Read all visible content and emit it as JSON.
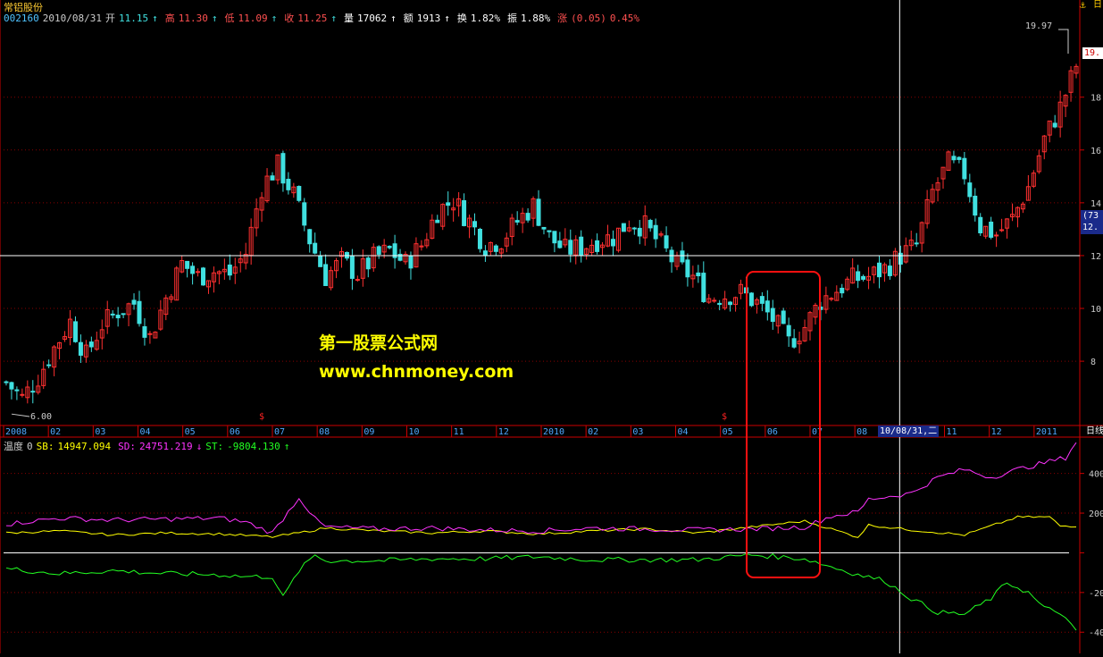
{
  "stock": {
    "name": "常铝股份",
    "code": "002160",
    "date": "2010/08/31",
    "open_label": "开",
    "open": "11.15",
    "high_label": "高",
    "high": "11.30",
    "low_label": "低",
    "low": "11.09",
    "close_label": "收",
    "close": "11.25",
    "vol_label": "量",
    "vol": "17062",
    "amt_label": "额",
    "amt": "1913",
    "turn_label": "换",
    "turn": "1.82%",
    "amp_label": "振",
    "amp": "1.88%",
    "chg_label": "涨",
    "chg": "(0.05)",
    "chg_pct": "0.45%"
  },
  "price_markers": {
    "max": "19.97",
    "min": "6.00",
    "right_tag": "19.",
    "cursor_tag1": "(73",
    "cursor_tag2": "12."
  },
  "watermark": {
    "line1": "第一股票公式网",
    "line2": "www.chnmoney.com"
  },
  "period_button": "日线",
  "cursor_date": "10/08/31,二",
  "signal_marker": "$",
  "indicator": {
    "name": "温度",
    "param": "0",
    "sb_label": "SB:",
    "sb_value": "14947.094",
    "sd_label": "SD:",
    "sd_value": "24751.219",
    "st_label": "ST:",
    "st_value": "-9804.130"
  },
  "colors": {
    "up": "#ff3030",
    "down": "#40e0e0",
    "sb": "#ffff00",
    "sd": "#ff33ff",
    "st": "#22ff22",
    "grid": "#880000",
    "axis": "#cc0000",
    "box": "#ff1010"
  },
  "chart_data": [
    {
      "type": "candlestick",
      "title": "",
      "x_tick_labels": [
        "2008",
        "02",
        "03",
        "04",
        "05",
        "06",
        "07",
        "08",
        "09",
        "10",
        "11",
        "12",
        "2010",
        "02",
        "03",
        "04",
        "05",
        "06",
        "07",
        "08",
        "10/08/31,二",
        "11",
        "12",
        "2011"
      ],
      "y_ticks": [
        8,
        10,
        12,
        14,
        16,
        18
      ],
      "ylim": [
        5.6,
        20.8
      ],
      "y_max_marked": 19.97,
      "y_min_marked": 6.0,
      "crosshair_y": 12.0,
      "close_path": [
        [
          0,
          7.2
        ],
        [
          3,
          6.6
        ],
        [
          6,
          7.4
        ],
        [
          9,
          8.5
        ],
        [
          12,
          9.5
        ],
        [
          15,
          8.2
        ],
        [
          18,
          9.4
        ],
        [
          21,
          9.9
        ],
        [
          24,
          10.2
        ],
        [
          27,
          8.9
        ],
        [
          30,
          10.4
        ],
        [
          33,
          11.7
        ],
        [
          36,
          11.2
        ],
        [
          39,
          11.4
        ],
        [
          42,
          11.3
        ],
        [
          45,
          12.1
        ],
        [
          48,
          14.6
        ],
        [
          51,
          15.4
        ],
        [
          54,
          14.3
        ],
        [
          57,
          12.6
        ],
        [
          60,
          11.2
        ],
        [
          63,
          11.8
        ],
        [
          66,
          11.3
        ],
        [
          69,
          11.9
        ],
        [
          72,
          12.2
        ],
        [
          75,
          11.7
        ],
        [
          78,
          12.4
        ],
        [
          81,
          13.7
        ],
        [
          84,
          14.1
        ],
        [
          87,
          13.3
        ],
        [
          90,
          12.4
        ],
        [
          93,
          12.6
        ],
        [
          96,
          13.3
        ],
        [
          99,
          13.9
        ],
        [
          102,
          12.7
        ],
        [
          105,
          12.2
        ],
        [
          108,
          12.3
        ],
        [
          111,
          12.6
        ],
        [
          114,
          12.7
        ],
        [
          117,
          13.3
        ],
        [
          120,
          13.1
        ],
        [
          123,
          12.4
        ],
        [
          126,
          11.6
        ],
        [
          129,
          11.2
        ],
        [
          132,
          10.4
        ],
        [
          135,
          10.5
        ],
        [
          138,
          10.6
        ],
        [
          141,
          10.2
        ],
        [
          144,
          9.6
        ],
        [
          147,
          8.7
        ],
        [
          150,
          9.3
        ],
        [
          153,
          10.3
        ],
        [
          156,
          10.7
        ],
        [
          159,
          11.1
        ],
        [
          162,
          11.2
        ],
        [
          165,
          11.5
        ],
        [
          168,
          12.0
        ],
        [
          171,
          12.4
        ],
        [
          174,
          14.4
        ],
        [
          177,
          15.5
        ],
        [
          180,
          15.1
        ],
        [
          183,
          13.1
        ],
        [
          186,
          12.8
        ],
        [
          189,
          13.4
        ],
        [
          192,
          14.6
        ],
        [
          195,
          16.4
        ],
        [
          198,
          17.6
        ],
        [
          201,
          19.2
        ]
      ],
      "n_candles": 202
    },
    {
      "type": "line",
      "title": "",
      "y_ticks": [
        400,
        200,
        0,
        -200,
        -400
      ],
      "ylim": [
        -480,
        520
      ],
      "series": [
        {
          "name": "SB",
          "points": [
            [
              0,
              100
            ],
            [
              10,
              110
            ],
            [
              20,
              90
            ],
            [
              30,
              100
            ],
            [
              40,
              95
            ],
            [
              50,
              80
            ],
            [
              55,
              100
            ],
            [
              60,
              125
            ],
            [
              70,
              110
            ],
            [
              80,
              100
            ],
            [
              90,
              110
            ],
            [
              100,
              95
            ],
            [
              110,
              110
            ],
            [
              120,
              120
            ],
            [
              130,
              100
            ],
            [
              140,
              130
            ],
            [
              150,
              160
            ],
            [
              160,
              80
            ],
            [
              162,
              140
            ],
            [
              170,
              115
            ],
            [
              180,
              90
            ],
            [
              190,
              180
            ],
            [
              196,
              180
            ],
            [
              198,
              135
            ],
            [
              201,
              135
            ]
          ]
        },
        {
          "name": "SD",
          "points": [
            [
              0,
              145
            ],
            [
              10,
              175
            ],
            [
              20,
              165
            ],
            [
              30,
              170
            ],
            [
              40,
              175
            ],
            [
              45,
              155
            ],
            [
              50,
              100
            ],
            [
              55,
              280
            ],
            [
              58,
              170
            ],
            [
              60,
              130
            ],
            [
              70,
              120
            ],
            [
              80,
              125
            ],
            [
              90,
              115
            ],
            [
              100,
              110
            ],
            [
              110,
              125
            ],
            [
              120,
              120
            ],
            [
              130,
              115
            ],
            [
              140,
              120
            ],
            [
              150,
              130
            ],
            [
              155,
              185
            ],
            [
              160,
              205
            ],
            [
              162,
              270
            ],
            [
              170,
              300
            ],
            [
              175,
              380
            ],
            [
              180,
              420
            ],
            [
              185,
              380
            ],
            [
              190,
              420
            ],
            [
              196,
              460
            ],
            [
              199,
              480
            ],
            [
              201,
              560
            ]
          ]
        },
        {
          "name": "ST",
          "points": [
            [
              0,
              -80
            ],
            [
              10,
              -105
            ],
            [
              20,
              -90
            ],
            [
              30,
              -105
            ],
            [
              40,
              -110
            ],
            [
              45,
              -120
            ],
            [
              50,
              -120
            ],
            [
              52,
              -225
            ],
            [
              55,
              -90
            ],
            [
              58,
              -10
            ],
            [
              60,
              -40
            ],
            [
              70,
              -40
            ],
            [
              80,
              -30
            ],
            [
              90,
              -30
            ],
            [
              100,
              -20
            ],
            [
              110,
              -35
            ],
            [
              120,
              -35
            ],
            [
              130,
              -35
            ],
            [
              140,
              -10
            ],
            [
              150,
              -30
            ],
            [
              155,
              -70
            ],
            [
              160,
              -110
            ],
            [
              165,
              -140
            ],
            [
              170,
              -230
            ],
            [
              175,
              -300
            ],
            [
              180,
              -310
            ],
            [
              185,
              -230
            ],
            [
              188,
              -150
            ],
            [
              192,
              -200
            ],
            [
              195,
              -280
            ],
            [
              198,
              -300
            ],
            [
              201,
              -400
            ]
          ]
        }
      ]
    }
  ]
}
